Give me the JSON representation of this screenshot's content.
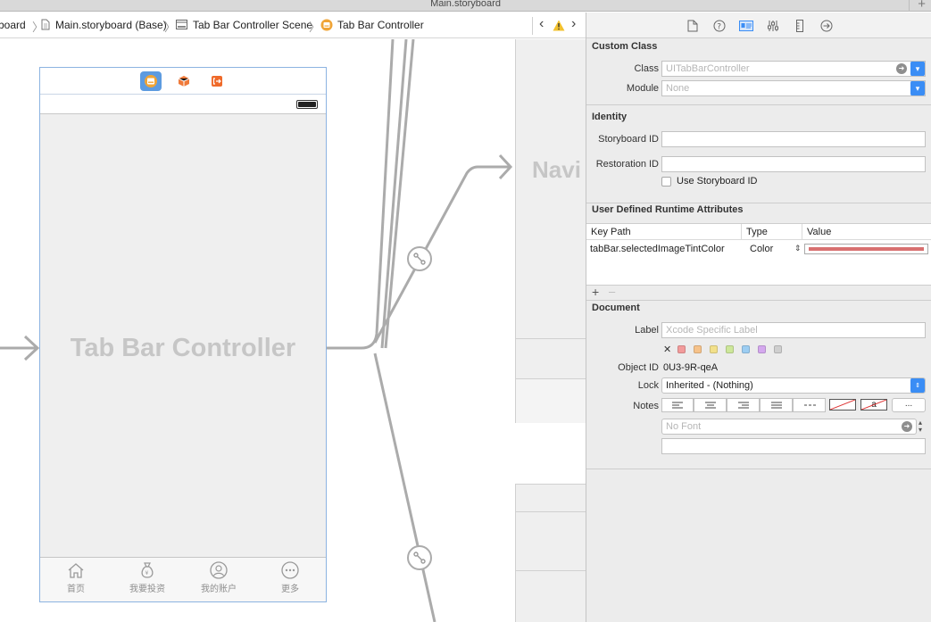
{
  "window": {
    "title": "Main.storyboard",
    "add_label": "+"
  },
  "jumpbar": {
    "crumbs": [
      "board",
      "Main.storyboard (Base)",
      "Tab Bar Controller Scene",
      "Tab Bar Controller"
    ],
    "prev": "‹",
    "next": "›"
  },
  "canvas": {
    "scene_title": "Tab Bar Controller",
    "next_scene_title": "Navi",
    "tabs": [
      {
        "label": "首页",
        "icon": "home-icon"
      },
      {
        "label": "我要投资",
        "icon": "money-bag-icon"
      },
      {
        "label": "我的账户",
        "icon": "account-icon"
      },
      {
        "label": "更多",
        "icon": "more-icon"
      }
    ]
  },
  "inspector": {
    "tabs": [
      "file-icon",
      "help-icon",
      "identity-icon",
      "attributes-icon",
      "size-icon",
      "connections-icon"
    ],
    "custom_class": {
      "title": "Custom Class",
      "class_label": "Class",
      "class_placeholder": "UITabBarController",
      "module_label": "Module",
      "module_placeholder": "None"
    },
    "identity": {
      "title": "Identity",
      "storyboard_id_label": "Storyboard ID",
      "storyboard_id_value": "",
      "restoration_id_label": "Restoration ID",
      "restoration_id_value": "",
      "use_storyboard_id_label": "Use Storyboard ID",
      "use_storyboard_id_checked": false
    },
    "runtime_attributes": {
      "title": "User Defined Runtime Attributes",
      "columns": [
        "Key Path",
        "Type",
        "Value"
      ],
      "rows": [
        {
          "key_path": "tabBar.selectedImageTintColor",
          "type": "Color",
          "value_color": "#d87070"
        }
      ],
      "add_label": "+",
      "remove_label": "–"
    },
    "document": {
      "title": "Document",
      "label_label": "Label",
      "label_placeholder": "Xcode Specific Label",
      "clear_label": "✕",
      "label_colors": [
        "#f29b9b",
        "#f6c28a",
        "#f2e08a",
        "#cde79a",
        "#9ccdf2",
        "#d4a8ee",
        "#cfcfcf"
      ],
      "object_id_label": "Object ID",
      "object_id_value": "0U3-9R-qeA",
      "lock_label": "Lock",
      "lock_value": "Inherited - (Nothing)",
      "notes_label": "Notes",
      "more_label": "...",
      "font_placeholder": "No Font",
      "notes_value": ""
    }
  },
  "colors": {
    "accent": "#3a8df5",
    "selection_border": "#8cb3e1",
    "tab_dock_icon_bg": "#f0a436",
    "cube_icon": "#ef7a3a",
    "exit_icon": "#ef6a2a"
  }
}
